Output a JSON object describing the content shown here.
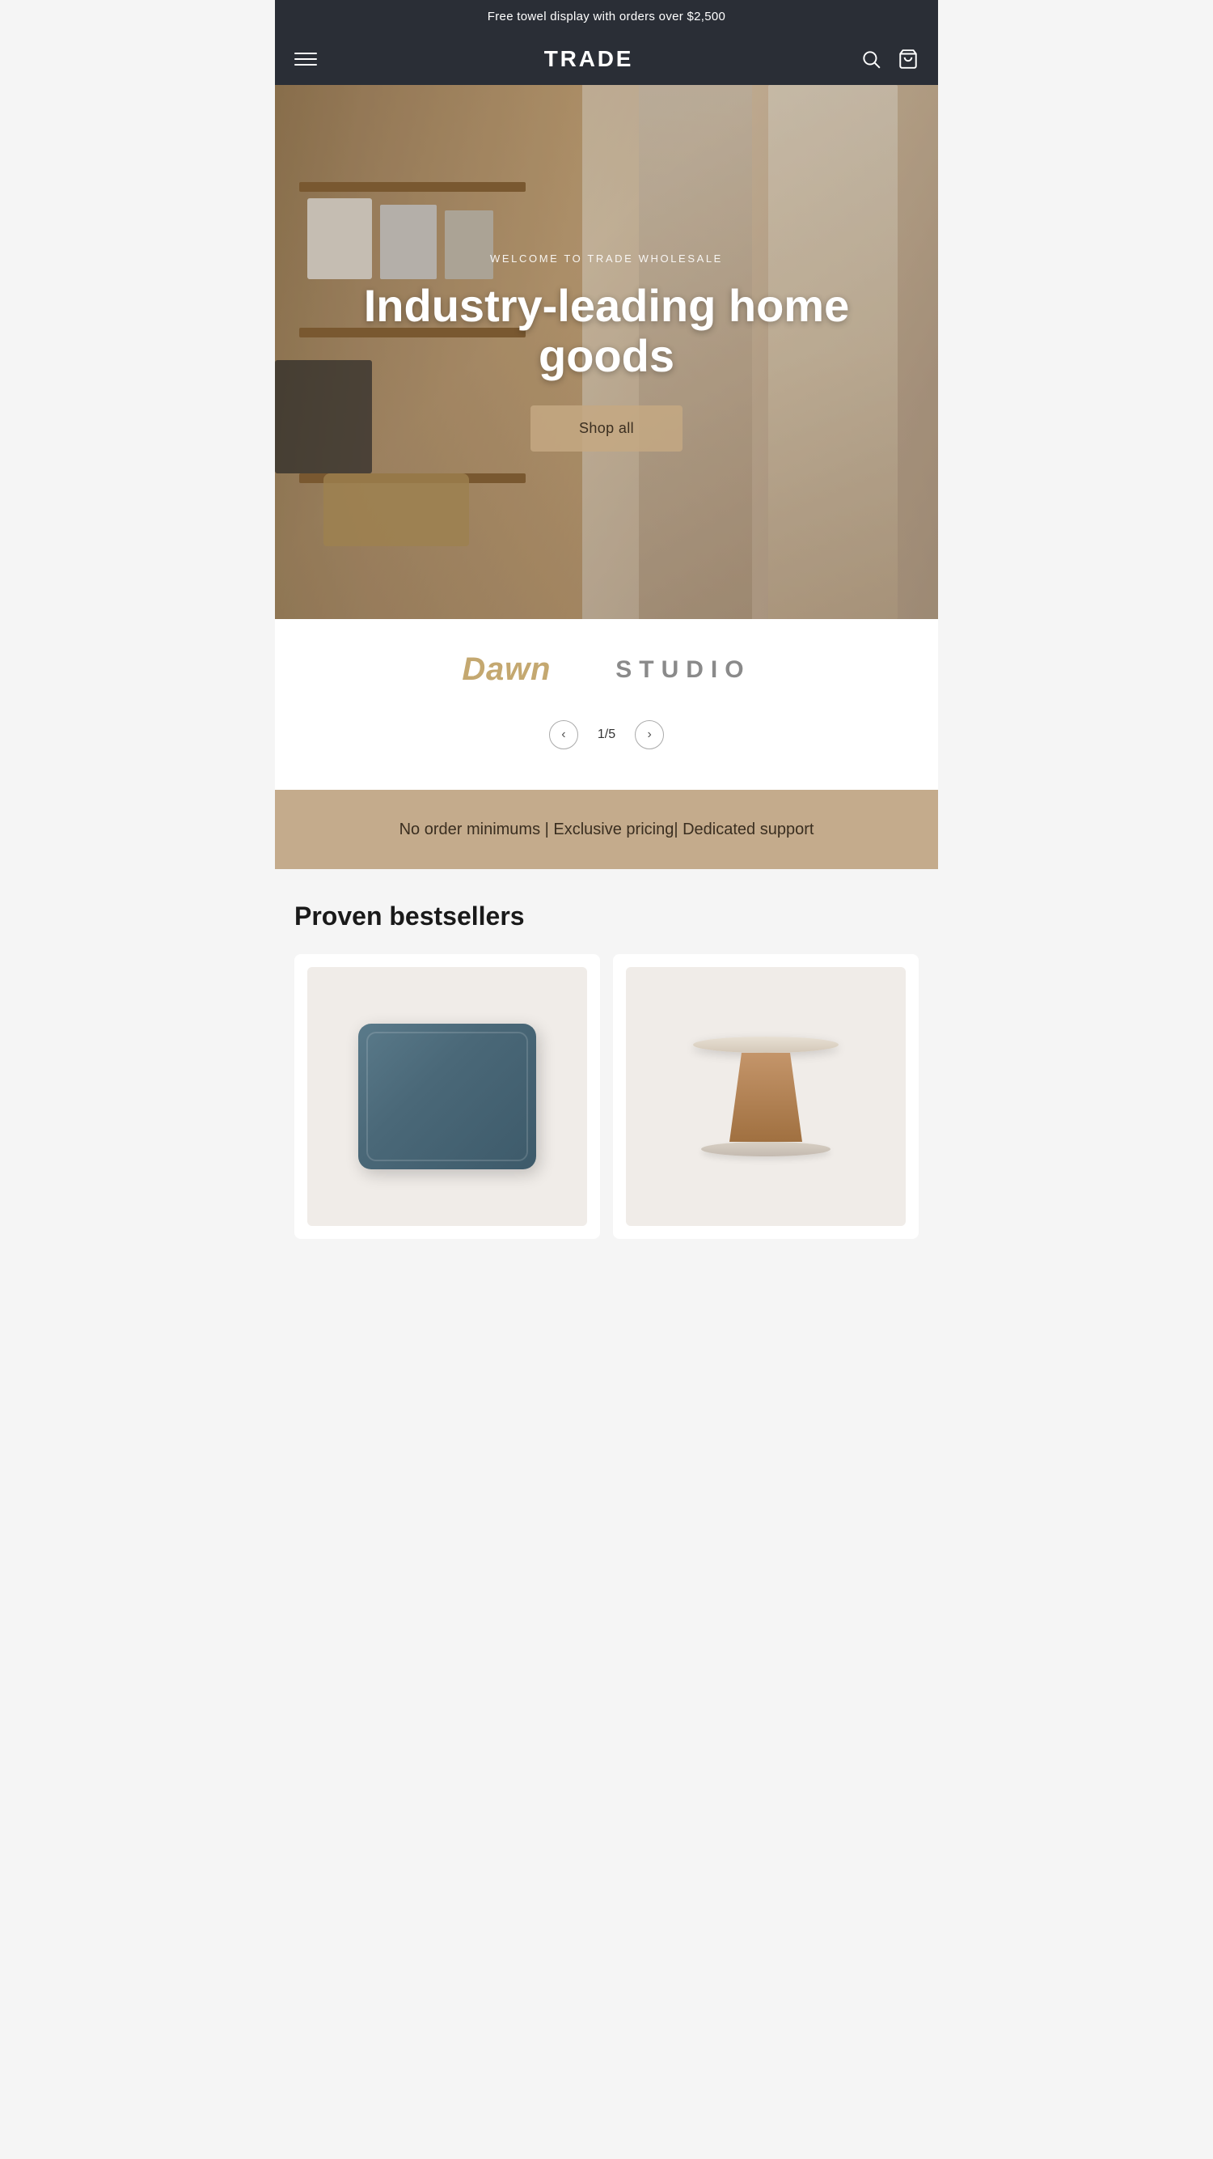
{
  "announcement": {
    "text": "Free towel display with orders over $2,500"
  },
  "header": {
    "logo": "TRADE",
    "menu_icon": "menu",
    "search_icon": "search",
    "cart_icon": "cart"
  },
  "hero": {
    "eyebrow": "WELCOME TO TRADE WHOLESALE",
    "title": "Industry-leading home goods",
    "cta_label": "Shop all"
  },
  "brands": {
    "brand1": "Dawn",
    "brand2": "STUDIO"
  },
  "pagination": {
    "current": "1",
    "total": "5",
    "separator": "/",
    "prev_label": "‹",
    "next_label": "›"
  },
  "features": {
    "text": "No order minimums | Exclusive pricing| Dedicated support"
  },
  "bestsellers": {
    "section_title": "Proven bestsellers",
    "products": [
      {
        "type": "pillow",
        "alt": "Blue linen pillow"
      },
      {
        "type": "side-table",
        "alt": "Marble and wood side table"
      }
    ]
  }
}
